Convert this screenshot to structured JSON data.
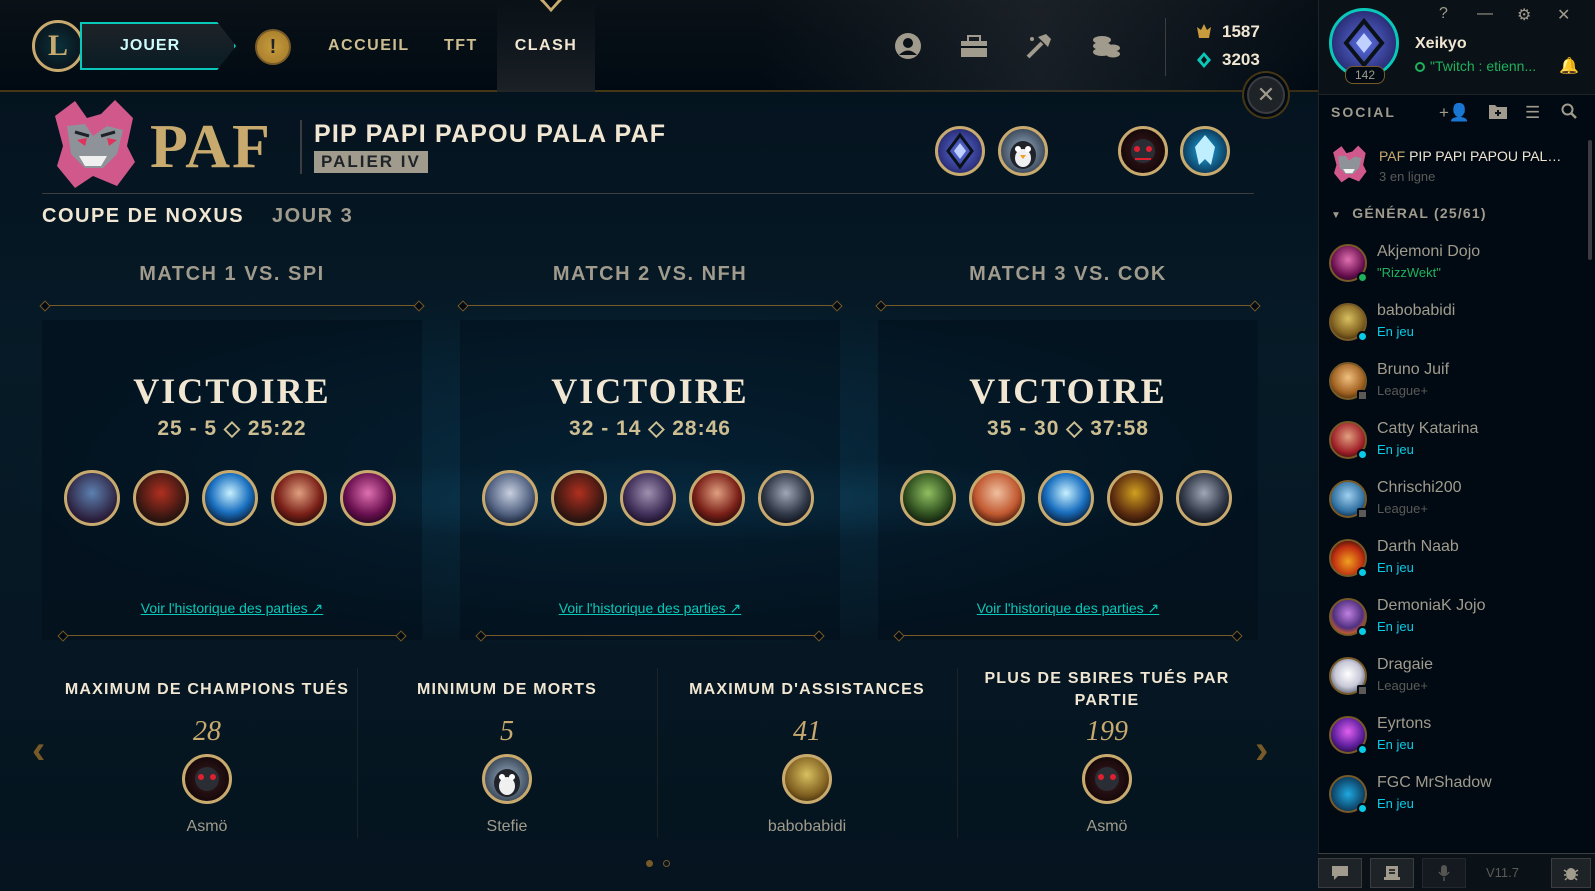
{
  "nav": {
    "play": "JOUER",
    "items": [
      "ACCUEIL",
      "TFT",
      "CLASH"
    ],
    "active": "CLASH"
  },
  "currency": {
    "rp": "1587",
    "be": "3203"
  },
  "team": {
    "tag": "PAF",
    "name": "PIP PAPI PAPOU PALA PAF",
    "tier": "PALIER IV"
  },
  "tournament": {
    "cup": "COUPE DE NOXUS",
    "day": "JOUR 3"
  },
  "matches": [
    {
      "title": "MATCH 1 VS. SPI",
      "result": "VICTOIRE",
      "score": "25 - 5",
      "duration": "25:22",
      "history": "Voir l'historique des parties ↗"
    },
    {
      "title": "MATCH 2 VS. NFH",
      "result": "VICTOIRE",
      "score": "32 - 14",
      "duration": "28:46",
      "history": "Voir l'historique des parties ↗"
    },
    {
      "title": "MATCH 3 VS. COK",
      "result": "VICTOIRE",
      "score": "35 - 30",
      "duration": "37:58",
      "history": "Voir l'historique des parties ↗"
    }
  ],
  "stats": [
    {
      "title": "MAXIMUM DE CHAMPIONS TUÉS",
      "value": "28",
      "player": "Asmö"
    },
    {
      "title": "MINIMUM DE MORTS",
      "value": "5",
      "player": "Stefie"
    },
    {
      "title": "MAXIMUM D'ASSISTANCES",
      "value": "41",
      "player": "babobabidi"
    },
    {
      "title": "PLUS DE SBIRES TUÉS PAR PARTIE",
      "value": "199",
      "player": "Asmö"
    }
  ],
  "profile": {
    "name": "Xeikyo",
    "level": "142",
    "status": "\"Twitch : etienn..."
  },
  "social": {
    "label": "SOCIAL",
    "club": {
      "tag": "PAF",
      "name": "PIP PAPI PAPOU PALA P...",
      "online": "3 en ligne"
    },
    "group": "GÉNÉRAL (25/61)",
    "friends": [
      {
        "name": "Akjemoni Dojo",
        "status": "\"RizzWekt\"",
        "state": "online"
      },
      {
        "name": "babobabidi",
        "status": "En jeu",
        "state": "ingame"
      },
      {
        "name": "Bruno Juif",
        "status": "League+",
        "state": "mobile"
      },
      {
        "name": "Catty Katarina",
        "status": "En jeu",
        "state": "ingame"
      },
      {
        "name": "Chrischi200",
        "status": "League+",
        "state": "mobile"
      },
      {
        "name": "Darth Naab",
        "status": "En jeu",
        "state": "ingame"
      },
      {
        "name": "DemoniaK Jojo",
        "status": "En jeu",
        "state": "ingame"
      },
      {
        "name": "Dragaie",
        "status": "League+",
        "state": "mobile"
      },
      {
        "name": "Eyrtons",
        "status": "En jeu",
        "state": "ingame"
      },
      {
        "name": "FGC MrShadow",
        "status": "En jeu",
        "state": "ingame"
      }
    ]
  },
  "footer": {
    "version": "V11.7"
  },
  "colors": {
    "gold": "#c8aa6e",
    "teal": "#0ac8b9",
    "online": "#1fb15c",
    "ingame": "#0acbe6",
    "background": "#010a13"
  }
}
